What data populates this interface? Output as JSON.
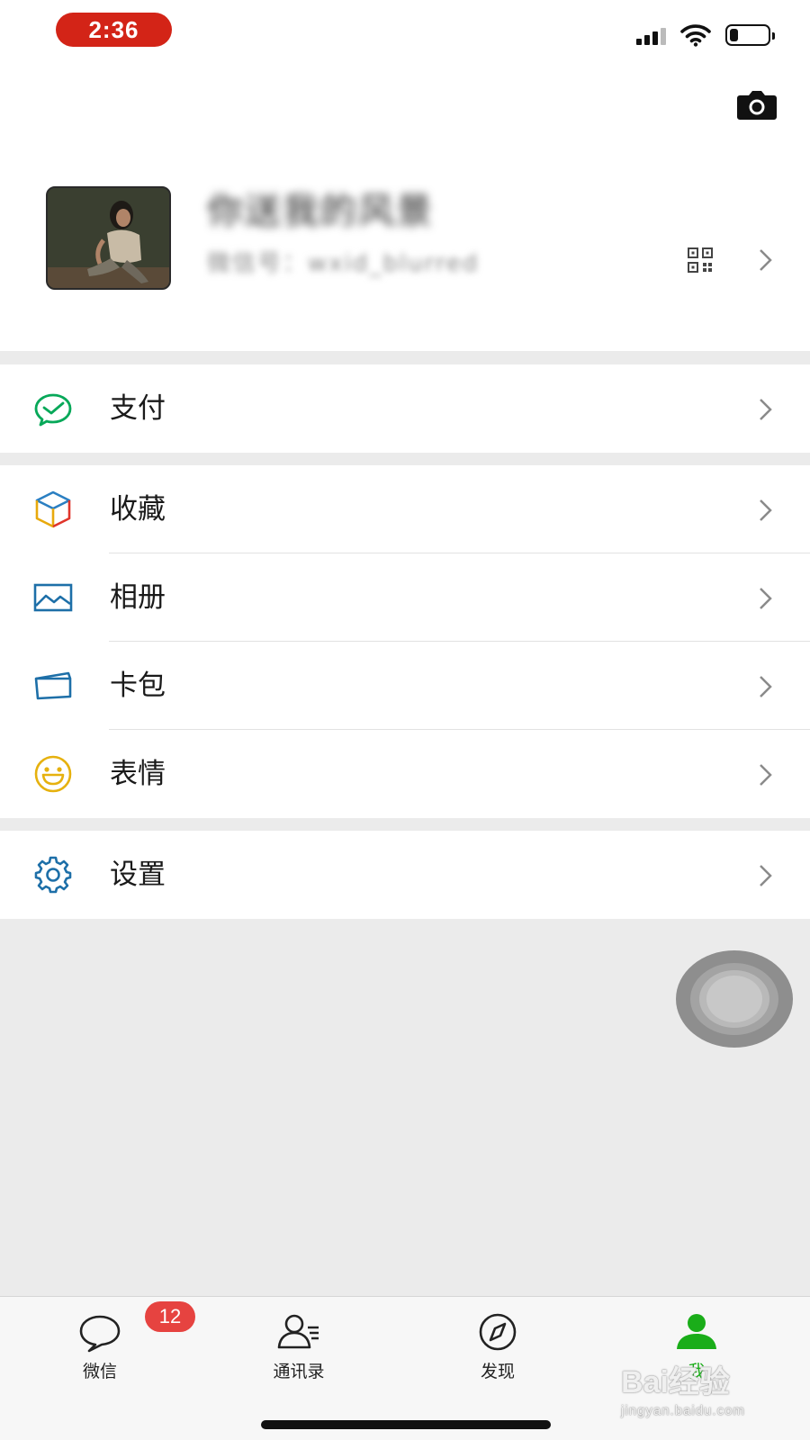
{
  "status_bar": {
    "time": "2:36",
    "icons": [
      "signal-icon",
      "wifi-icon",
      "battery-icon"
    ],
    "battery_level": 0.2,
    "accent_color": "#d32417"
  },
  "profile": {
    "nickname": "你送我的风景",
    "wechat_id": "微信号：wxid_blurred",
    "icons": [
      "camera-icon",
      "qr-code-icon",
      "chevron-right-icon"
    ]
  },
  "menu": {
    "pay": {
      "label": "支付",
      "icon": "wechat-pay-icon"
    },
    "favorites": {
      "label": "收藏",
      "icon": "favorites-cube-icon"
    },
    "album": {
      "label": "相册",
      "icon": "album-picture-icon"
    },
    "cards": {
      "label": "卡包",
      "icon": "card-wallet-icon"
    },
    "stickers": {
      "label": "表情",
      "icon": "smiley-icon"
    },
    "settings": {
      "label": "设置",
      "icon": "gear-icon"
    }
  },
  "tabbar": {
    "tabs": [
      {
        "label": "微信",
        "icon": "chat-bubble-icon",
        "badge": "12"
      },
      {
        "label": "通讯录",
        "icon": "contacts-icon"
      },
      {
        "label": "发现",
        "icon": "compass-icon"
      },
      {
        "label": "我",
        "icon": "person-icon",
        "active": true
      }
    ],
    "active_color": "#1aad19",
    "badge_color": "#e64340"
  },
  "watermark": {
    "line1": "Bai经验",
    "line2": "jingyan.baidu.com"
  }
}
